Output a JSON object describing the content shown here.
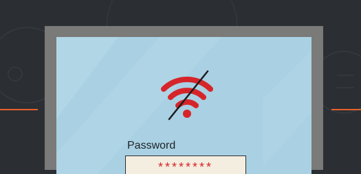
{
  "colors": {
    "background": "#2b2e33",
    "accent_line": "#e8622a",
    "monitor_frame": "#7a7a79",
    "screen": "#a9d1e3",
    "wifi_icon": "#d6252a",
    "slash": "#1c1d20",
    "field_bg": "#f4eee0",
    "password_text": "#d6252a"
  },
  "icons": {
    "wifi": "wifi-disconnected-icon"
  },
  "login": {
    "password_label": "Password",
    "password_value": "********"
  }
}
